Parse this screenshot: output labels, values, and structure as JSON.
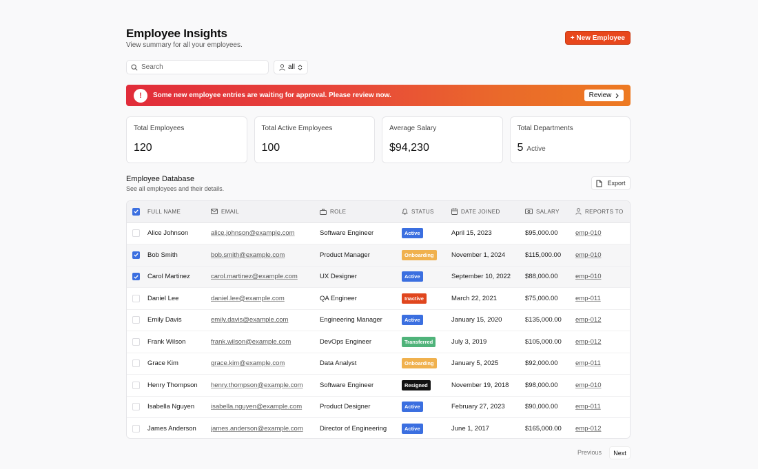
{
  "header": {
    "title": "Employee Insights",
    "subtitle": "View summary for all your employees.",
    "new_button": "+ New Employee"
  },
  "search": {
    "placeholder": "Search",
    "filter_value": "all"
  },
  "banner": {
    "icon": "!",
    "message": "Some new employee entries are waiting for approval. Please review now.",
    "button": "Review"
  },
  "stats": [
    {
      "label": "Total Employees",
      "value": "120",
      "suffix": ""
    },
    {
      "label": "Total Active Employees",
      "value": "100",
      "suffix": ""
    },
    {
      "label": "Average Salary",
      "value": "$94,230",
      "suffix": ""
    },
    {
      "label": "Total Departments",
      "value": "5",
      "suffix": "Active"
    }
  ],
  "database": {
    "title": "Employee Database",
    "subtitle": "See all employees and their details.",
    "export_label": "Export"
  },
  "table": {
    "columns": [
      "FULL NAME",
      "EMAIL",
      "ROLE",
      "STATUS",
      "DATE JOINED",
      "SALARY",
      "REPORTS TO"
    ],
    "rows": [
      {
        "checked": false,
        "name": "Alice Johnson",
        "email": "alice.johnson@example.com",
        "role": "Software Engineer",
        "status": "Active",
        "joined": "April 15, 2023",
        "salary": "$95,000.00",
        "reports_to": "emp-010"
      },
      {
        "checked": true,
        "name": "Bob Smith",
        "email": "bob.smith@example.com",
        "role": "Product Manager",
        "status": "Onboarding",
        "joined": "November 1, 2024",
        "salary": "$115,000.00",
        "reports_to": "emp-010"
      },
      {
        "checked": true,
        "name": "Carol Martinez",
        "email": "carol.martinez@example.com",
        "role": "UX Designer",
        "status": "Active",
        "joined": "September 10, 2022",
        "salary": "$88,000.00",
        "reports_to": "emp-010"
      },
      {
        "checked": false,
        "name": "Daniel Lee",
        "email": "daniel.lee@example.com",
        "role": "QA Engineer",
        "status": "Inactive",
        "joined": "March 22, 2021",
        "salary": "$75,000.00",
        "reports_to": "emp-011"
      },
      {
        "checked": false,
        "name": "Emily Davis",
        "email": "emily.davis@example.com",
        "role": "Engineering Manager",
        "status": "Active",
        "joined": "January 15, 2020",
        "salary": "$135,000.00",
        "reports_to": "emp-012"
      },
      {
        "checked": false,
        "name": "Frank Wilson",
        "email": "frank.wilson@example.com",
        "role": "DevOps Engineer",
        "status": "Transferred",
        "joined": "July 3, 2019",
        "salary": "$105,000.00",
        "reports_to": "emp-012"
      },
      {
        "checked": false,
        "name": "Grace Kim",
        "email": "grace.kim@example.com",
        "role": "Data Analyst",
        "status": "Onboarding",
        "joined": "January 5, 2025",
        "salary": "$92,000.00",
        "reports_to": "emp-011"
      },
      {
        "checked": false,
        "name": "Henry Thompson",
        "email": "henry.thompson@example.com",
        "role": "Software Engineer",
        "status": "Resigned",
        "joined": "November 19, 2018",
        "salary": "$98,000.00",
        "reports_to": "emp-010"
      },
      {
        "checked": false,
        "name": "Isabella Nguyen",
        "email": "isabella.nguyen@example.com",
        "role": "Product Designer",
        "status": "Active",
        "joined": "February 27, 2023",
        "salary": "$90,000.00",
        "reports_to": "emp-011"
      },
      {
        "checked": false,
        "name": "James Anderson",
        "email": "james.anderson@example.com",
        "role": "Director of Engineering",
        "status": "Active",
        "joined": "June 1, 2017",
        "salary": "$165,000.00",
        "reports_to": "emp-012"
      }
    ]
  },
  "status_colors": {
    "Active": "#3b6fe0",
    "Onboarding": "#f0b14e",
    "Inactive": "#e0461e",
    "Transferred": "#4fb37a",
    "Resigned": "#111111"
  },
  "colors": {
    "accent": "#e8471c",
    "checkbox": "#3b6fe0"
  },
  "pagination": {
    "previous": "Previous",
    "next": "Next"
  }
}
